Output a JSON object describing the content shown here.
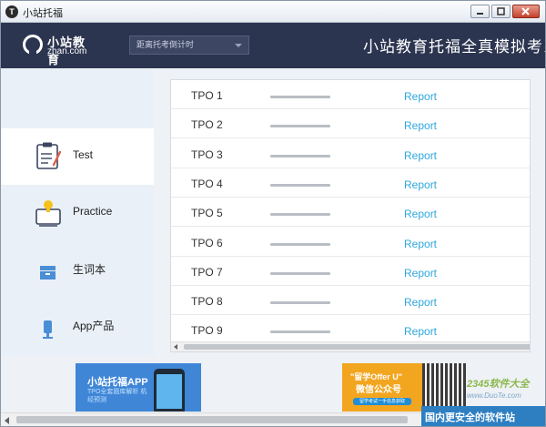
{
  "window": {
    "title": "小站托福",
    "app_icon": "T",
    "controls": [
      "minimize-icon",
      "maximize-icon",
      "close-icon"
    ]
  },
  "header": {
    "logo_text": "小站教育",
    "logo_sub": "zhan.com",
    "countdown_label": "距离托考倒计时",
    "title": "小站教育托福全真模拟考系"
  },
  "sidebar": {
    "items": [
      {
        "label": "Test",
        "icon": "test-clipboard-icon",
        "active": true
      },
      {
        "label": "Practice",
        "icon": "practice-board-icon",
        "active": false
      },
      {
        "label": "生词本",
        "icon": "wordbook-icon",
        "active": false
      },
      {
        "label": "App产品",
        "icon": "app-product-icon",
        "active": false
      }
    ]
  },
  "tpo_list": {
    "rows": [
      {
        "name": "TPO 1",
        "action": "Report"
      },
      {
        "name": "TPO 2",
        "action": "Report"
      },
      {
        "name": "TPO 3",
        "action": "Report"
      },
      {
        "name": "TPO 4",
        "action": "Report"
      },
      {
        "name": "TPO 5",
        "action": "Report"
      },
      {
        "name": "TPO 6",
        "action": "Report"
      },
      {
        "name": "TPO 7",
        "action": "Report"
      },
      {
        "name": "TPO 8",
        "action": "Report"
      },
      {
        "name": "TPO 9",
        "action": "Report"
      }
    ]
  },
  "banners": {
    "left_title": "小站托福APP",
    "left_sub": "TPO全套题库解析 机经预测",
    "right_title": "\"留学Offer U\"",
    "right_sub": "微信公众号",
    "right_small": "留学考试一手信息获取"
  },
  "watermark": {
    "brand": "2345软件大全",
    "url": "www.DuoTe.com",
    "bar": "国内更安全的软件站"
  },
  "colors": {
    "header_bg": "#2c3550",
    "link": "#2ea7dc",
    "sidebar_bg": "#e9f0f7",
    "banner_blue": "#3f86d6",
    "banner_orange": "#f2a51e"
  }
}
